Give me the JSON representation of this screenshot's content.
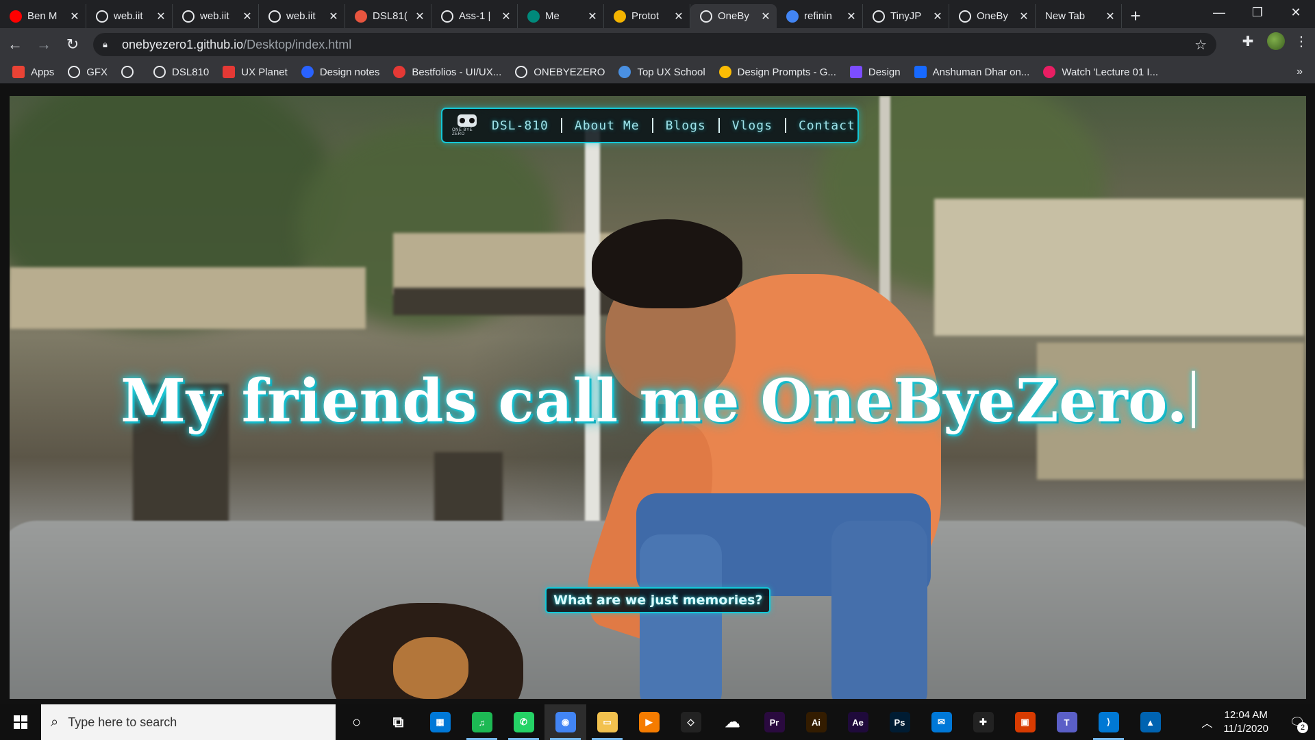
{
  "browser": {
    "tabs": [
      {
        "title": "Ben M",
        "icon": "youtube-icon",
        "color": "#ff0000"
      },
      {
        "title": "web.iit",
        "icon": "globe-icon",
        "color": "#e8eaed"
      },
      {
        "title": "web.iit",
        "icon": "globe-icon",
        "color": "#e8eaed"
      },
      {
        "title": "web.iit",
        "icon": "globe-icon",
        "color": "#e8eaed"
      },
      {
        "title": "DSL81(",
        "icon": "adobe-icon",
        "color": "#e8553f"
      },
      {
        "title": "Ass-1 |",
        "icon": "globe-icon",
        "color": "#e8eaed"
      },
      {
        "title": "Me",
        "icon": "meet-icon",
        "color": "#00897b"
      },
      {
        "title": "Protot",
        "icon": "slides-icon",
        "color": "#f4b400"
      },
      {
        "title": "OneBy",
        "icon": "globe-icon",
        "color": "#e8eaed"
      },
      {
        "title": "refinin",
        "icon": "google-icon",
        "color": "#4285f4"
      },
      {
        "title": "TinyJP",
        "icon": "panda-icon",
        "color": "#e8eaed"
      },
      {
        "title": "OneBy",
        "icon": "globe-icon",
        "color": "#e8eaed"
      },
      {
        "title": "New Tab",
        "icon": "",
        "color": ""
      }
    ],
    "active_tab_index": 8,
    "url_host": "onebyezero1.github.io",
    "url_path": "/Desktop/index.html",
    "bookmarks": [
      {
        "label": "Apps",
        "icon": "apps-grid-icon",
        "color": "#ea4335"
      },
      {
        "label": "GFX",
        "icon": "globe-icon",
        "color": "#e8eaed"
      },
      {
        "label": "",
        "icon": "globe-icon",
        "color": "#e8eaed"
      },
      {
        "label": "DSL810",
        "icon": "globe-icon",
        "color": "#e8eaed"
      },
      {
        "label": "UX Planet",
        "icon": "ux-icon",
        "color": "#e53935"
      },
      {
        "label": "Design notes",
        "icon": "compass-icon",
        "color": "#2962ff"
      },
      {
        "label": "Bestfolios - UI/UX...",
        "icon": "bestfolios-icon",
        "color": "#e53935"
      },
      {
        "label": "ONEBYEZERO",
        "icon": "globe-icon",
        "color": "#e8eaed"
      },
      {
        "label": "Top UX School",
        "icon": "triangle-icon",
        "color": "#4a90e2"
      },
      {
        "label": "Design Prompts - G...",
        "icon": "drive-icon",
        "color": "#fbbc04"
      },
      {
        "label": "Design",
        "icon": "design-icon",
        "color": "#7c4dff"
      },
      {
        "label": "Anshuman Dhar on...",
        "icon": "behance-icon",
        "color": "#1769ff"
      },
      {
        "label": "Watch 'Lecture 01 I...",
        "icon": "play-icon",
        "color": "#e91e63"
      }
    ]
  },
  "site": {
    "logo_label": "ONE BYE ZERO",
    "nav": [
      "DSL-810",
      "About Me",
      "Blogs",
      "Vlogs",
      "Contact"
    ],
    "headline": "My friends call me OneByeZero.",
    "tagline": "What are we just memories?",
    "accent": "#14c8d8"
  },
  "taskbar": {
    "search_placeholder": "Type here to search",
    "apps": [
      {
        "name": "cortana-icon",
        "label": "○",
        "color": "transparent"
      },
      {
        "name": "task-view-icon",
        "label": "⧉",
        "color": "transparent"
      },
      {
        "name": "store-icon",
        "label": "▦",
        "color": "#0078d7"
      },
      {
        "name": "spotify-icon",
        "label": "♫",
        "color": "#1db954"
      },
      {
        "name": "whatsapp-icon",
        "label": "✆",
        "color": "#25d366"
      },
      {
        "name": "chrome-icon",
        "label": "◉",
        "color": "#4285f4"
      },
      {
        "name": "file-explorer-icon",
        "label": "▭",
        "color": "#f2c14e"
      },
      {
        "name": "media-player-icon",
        "label": "▶",
        "color": "#f57c00"
      },
      {
        "name": "unity-icon",
        "label": "◇",
        "color": "#222222"
      },
      {
        "name": "onedrive-icon",
        "label": "☁",
        "color": "transparent"
      },
      {
        "name": "premiere-icon",
        "label": "Pr",
        "color": "#2a0a3f"
      },
      {
        "name": "illustrator-icon",
        "label": "Ai",
        "color": "#331c00"
      },
      {
        "name": "after-effects-icon",
        "label": "Ae",
        "color": "#1f0a3b"
      },
      {
        "name": "photoshop-icon",
        "label": "Ps",
        "color": "#001c33"
      },
      {
        "name": "mail-icon",
        "label": "✉",
        "color": "#0078d7"
      },
      {
        "name": "figma-icon",
        "label": "✚",
        "color": "#222222"
      },
      {
        "name": "office-icon",
        "label": "▣",
        "color": "#d83b01"
      },
      {
        "name": "teams-icon",
        "label": "T",
        "color": "#5b5fc7"
      },
      {
        "name": "vscode-icon",
        "label": "⟩",
        "color": "#0078d4"
      },
      {
        "name": "photos-icon",
        "label": "▲",
        "color": "#0063b1"
      }
    ],
    "time": "12:04 AM",
    "date": "11/1/2020",
    "notification_count": "2"
  }
}
